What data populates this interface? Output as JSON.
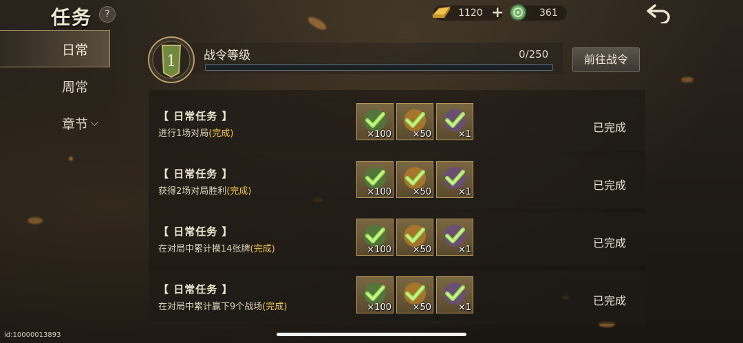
{
  "header": {
    "title": "任务",
    "help": "?",
    "gold": "1120",
    "jade": "361"
  },
  "nav": {
    "items": [
      {
        "label": "日常"
      },
      {
        "label": "周常"
      },
      {
        "label": "章节"
      }
    ]
  },
  "rank": {
    "level": "1",
    "label": "战令等级",
    "count": "0/250",
    "progress": 0,
    "button": "前往战令"
  },
  "tasks": [
    {
      "title": "【 日常任务 】",
      "desc": "进行1场对局",
      "done_tag": "(完成)",
      "rewards": [
        "×100",
        "×50",
        "×1"
      ],
      "status": "已完成"
    },
    {
      "title": "【 日常任务 】",
      "desc": "获得2场对局胜利",
      "done_tag": "(完成)",
      "rewards": [
        "×100",
        "×50",
        "×1"
      ],
      "status": "已完成"
    },
    {
      "title": "【 日常任务 】",
      "desc": "在对局中累计摸14张牌",
      "done_tag": "(完成)",
      "rewards": [
        "×100",
        "×50",
        "×1"
      ],
      "status": "已完成"
    },
    {
      "title": "【 日常任务 】",
      "desc": "在对局中累计赢下9个战场",
      "done_tag": "(完成)",
      "rewards": [
        "×100",
        "×50",
        "×1"
      ],
      "status": "已完成"
    }
  ],
  "footer": {
    "uid": "id:10000013893"
  },
  "icons": {
    "back": "back-arrow-icon",
    "gold": "gold-ingot-icon",
    "jade": "jade-coin-icon",
    "check": "check-icon"
  }
}
